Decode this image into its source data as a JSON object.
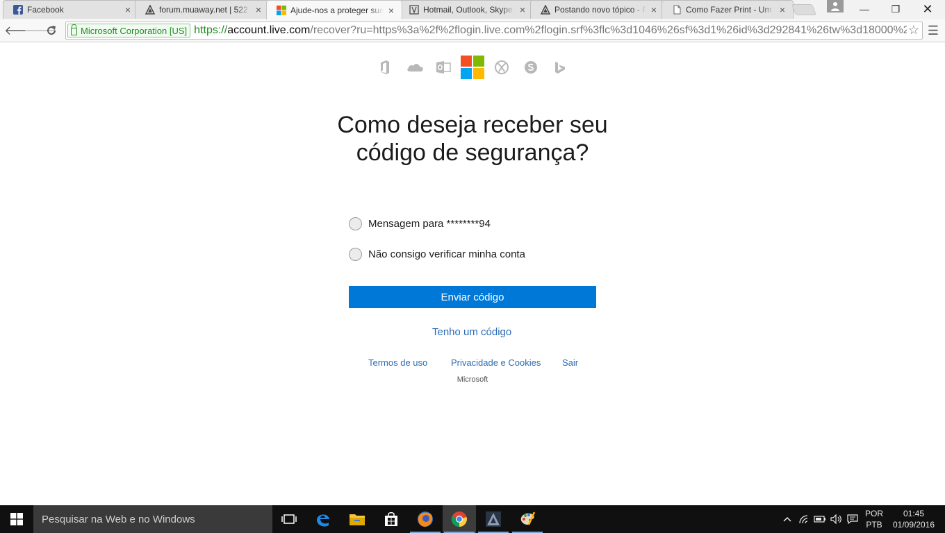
{
  "browser": {
    "tabs": [
      {
        "title": "Facebook",
        "favicon": "facebook-icon"
      },
      {
        "title": "forum.muaway.net | 522",
        "favicon": "mu-icon"
      },
      {
        "title": "Ajude-nos a proteger sua",
        "favicon": "microsoft-icon"
      },
      {
        "title": "Hotmail, Outlook, Skype,",
        "favicon": "hotmail-icon"
      },
      {
        "title": "Postando novo tópico - F",
        "favicon": "mu-icon"
      },
      {
        "title": "Como Fazer Print - Um je",
        "favicon": "document-icon"
      }
    ],
    "ev_badge": "Microsoft Corporation [US]",
    "url_scheme": "https://",
    "url_host": "account.live.com",
    "url_path": "/recover?ru=https%3a%2f%2flogin.live.com%2flogin.srf%3flc%3d1046%26sf%3d1%26id%3d292841%26tw%3d18000%26"
  },
  "page": {
    "brand_icons": [
      "office-icon",
      "onedrive-icon",
      "outlook-icon",
      "microsoft-logo",
      "xbox-icon",
      "skype-icon",
      "bing-icon"
    ],
    "heading": "Como deseja receber seu código de segurança?",
    "options": [
      "Mensagem para ********94",
      "Não consigo verificar minha conta"
    ],
    "submit_label": "Enviar código",
    "have_code_link": "Tenho um código",
    "footer_links": [
      "Termos de uso",
      "Privacidade e Cookies",
      "Sair"
    ],
    "footer_copyright": "Microsoft",
    "accent_color": "#0078d7"
  },
  "taskbar": {
    "search_placeholder": "Pesquisar na Web e no Windows",
    "apps": [
      "task-view-icon",
      "edge-icon",
      "file-explorer-icon",
      "store-icon",
      "firefox-icon",
      "chrome-icon",
      "mu-game-icon",
      "paint-icon"
    ],
    "language_line1": "POR",
    "language_line2": "PTB",
    "time": "01:45",
    "date": "01/09/2016"
  }
}
